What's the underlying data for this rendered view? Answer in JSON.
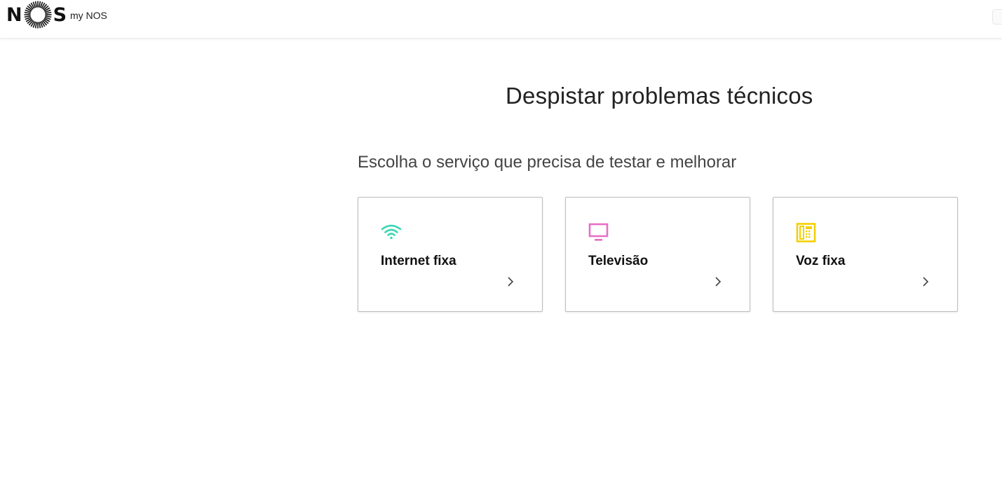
{
  "header": {
    "logo_text_left": "N",
    "logo_text_right": "S",
    "app_name": "my NOS"
  },
  "main": {
    "title": "Despistar problemas técnicos",
    "subtitle": "Escolha o serviço que precisa de testar e melhorar",
    "services": [
      {
        "label": "Internet fixa",
        "icon": "wifi-icon",
        "color": "#3dd6b5"
      },
      {
        "label": "Televisão",
        "icon": "tv-icon",
        "color": "#e86fc6"
      },
      {
        "label": "Voz fixa",
        "icon": "phone-icon",
        "color": "#f4d000"
      }
    ]
  }
}
